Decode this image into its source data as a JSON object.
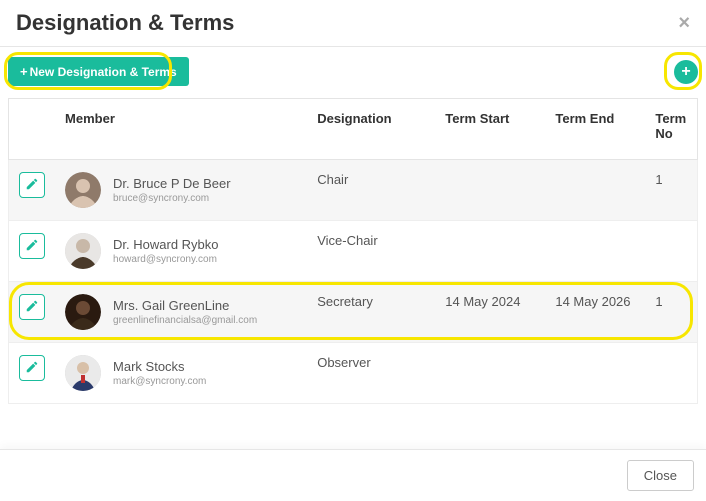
{
  "header": {
    "title": "Designation & Terms",
    "close_x": "×"
  },
  "toolbar": {
    "new_label": "New Designation & Terms",
    "fab_label": "+"
  },
  "table": {
    "headers": {
      "edit": "",
      "member": "Member",
      "designation": "Designation",
      "term_start": "Term Start",
      "term_end": "Term End",
      "term_no": "Term No"
    },
    "rows": [
      {
        "name": "Dr. Bruce P De Beer",
        "email": "bruce@syncrony.com",
        "designation": "Chair",
        "term_start": "",
        "term_end": "",
        "term_no": "1"
      },
      {
        "name": "Dr. Howard Rybko",
        "email": "howard@syncrony.com",
        "designation": "Vice-Chair",
        "term_start": "",
        "term_end": "",
        "term_no": ""
      },
      {
        "name": "Mrs. Gail GreenLine",
        "email": "greenlinefinancialsa@gmail.com",
        "designation": "Secretary",
        "term_start": "14 May 2024",
        "term_end": "14 May 2026",
        "term_no": "1"
      },
      {
        "name": "Mark Stocks",
        "email": "mark@syncrony.com",
        "designation": "Observer",
        "term_start": "",
        "term_end": "",
        "term_no": ""
      }
    ]
  },
  "footer": {
    "close_label": "Close"
  },
  "colors": {
    "accent": "#1abc9c",
    "highlight": "#f7e600"
  }
}
